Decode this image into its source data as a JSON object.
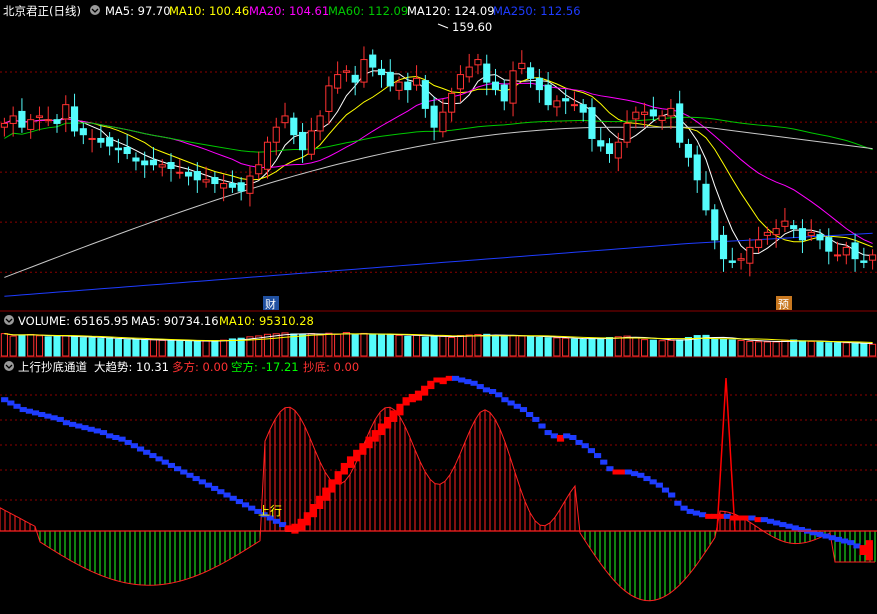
{
  "colors": {
    "background": "#000000",
    "up": "#FF3232",
    "down": "#54FCFC",
    "ma5": "#FFFFFF",
    "ma10": "#FFFF00",
    "ma20": "#FF00FF",
    "ma60": "#00C800",
    "ma120": "#C8C8C8",
    "ma250": "#1E3CFF",
    "grid": "#8B0000",
    "osc_bear": "#1E3CFF",
    "osc_bull": "#FF0000",
    "hist_pos": "#FF2020",
    "hist_neg": "#20FF20"
  },
  "price_panel": {
    "title": "北京君正(日线)",
    "legend": [
      {
        "label": "MA5: 97.70",
        "color": "#FFFFFF"
      },
      {
        "label": "MA10: 100.46",
        "color": "#FFFF00"
      },
      {
        "label": "MA20: 104.61",
        "color": "#FF00FF"
      },
      {
        "label": "MA60: 112.09",
        "color": "#00C800"
      },
      {
        "label": "MA120: 124.09",
        "color": "#FFFFFF"
      },
      {
        "label": "MA250: 112.56",
        "color": "#1E3CFF"
      }
    ],
    "peak_label": "159.60",
    "markers": [
      {
        "text": "财",
        "bg": "#2050A0",
        "fg": "#FFFFFF"
      },
      {
        "text": "预",
        "bg": "#C87820",
        "fg": "#FFFFFF"
      }
    ]
  },
  "volume_panel": {
    "legend": [
      {
        "label": "VOLUME: 65165.95",
        "color": "#FFFFFF"
      },
      {
        "label": "MA5: 90734.16",
        "color": "#FFFFFF"
      },
      {
        "label": "MA10: 95310.28",
        "color": "#FFFF00"
      }
    ]
  },
  "indicator_panel": {
    "legend": [
      {
        "label": "上行抄底通道",
        "color": "#FFFFFF"
      },
      {
        "label": "大趋势: 10.31",
        "color": "#FFFFFF"
      },
      {
        "label": "多方: 0.00",
        "color": "#FF3232"
      },
      {
        "label": "空方: -17.21",
        "color": "#00FF00"
      },
      {
        "label": "抄底: 0.00",
        "color": "#FF3232"
      }
    ],
    "annotation": "上行"
  },
  "chart_data": [
    {
      "type": "candlestick",
      "title": "北京君正(日线)",
      "bars": 100,
      "price_range": [
        88,
        162
      ],
      "peak": 159.6,
      "ma": {
        "MA5": 97.7,
        "MA10": 100.46,
        "MA20": 104.61,
        "MA60": 112.09,
        "MA120": 124.09,
        "MA250": 112.56
      },
      "closes": [
        135,
        137,
        134,
        136,
        137,
        136,
        135,
        140,
        133,
        132,
        131,
        130,
        129,
        128,
        127,
        125,
        124,
        124,
        124,
        123,
        122,
        121,
        120,
        120,
        119,
        119,
        118,
        117,
        121,
        124,
        130,
        134,
        137,
        132,
        128,
        133,
        137,
        145,
        148,
        149,
        146,
        152,
        150,
        148,
        145,
        146,
        144,
        147,
        139,
        134,
        138,
        143,
        148,
        150,
        152,
        146,
        144,
        141,
        149,
        151,
        147,
        144,
        140,
        141,
        141,
        140,
        138,
        131,
        129,
        127,
        130,
        135,
        138,
        138,
        137,
        137,
        139,
        130,
        126,
        120,
        112,
        104,
        99,
        98,
        99,
        102,
        104,
        106,
        107,
        109,
        107,
        104,
        106,
        104,
        101,
        100,
        102,
        99,
        98,
        100
      ],
      "grid": true
    },
    {
      "type": "bar",
      "title": "VOLUME",
      "values": [
        126000,
        112000,
        118000,
        121000,
        114000,
        108000,
        110000,
        113000,
        108000,
        103000,
        101000,
        98000,
        99000,
        94000,
        92000,
        90000,
        90000,
        91000,
        88000,
        87000,
        84000,
        84000,
        82000,
        84000,
        86000,
        89000,
        96000,
        100000,
        108000,
        113000,
        122000,
        125000,
        130000,
        124000,
        120000,
        126000,
        118000,
        128000,
        122000,
        132000,
        118000,
        127000,
        123000,
        119000,
        121000,
        116000,
        110000,
        116000,
        106000,
        113000,
        110000,
        104000,
        115000,
        118000,
        121000,
        122000,
        114000,
        111000,
        114000,
        112000,
        111000,
        104000,
        103000,
        102000,
        100000,
        95000,
        93000,
        98000,
        101000,
        104000,
        108000,
        112000,
        103000,
        92000,
        89000,
        86000,
        88000,
        91000,
        104000,
        115000,
        116000,
        96000,
        93000,
        90000,
        87000,
        82000,
        80000,
        79000,
        79000,
        88000,
        90000,
        85000,
        82000,
        78000,
        75000,
        73000,
        74000,
        70000,
        68000,
        66000
      ],
      "ma5": 90734.16,
      "ma10": 95310.28
    },
    {
      "type": "line",
      "title": "上行抄底通道",
      "series": [
        {
          "name": "大趋势",
          "values": [
            88,
            86,
            84,
            82,
            81,
            80,
            79,
            78,
            77,
            76,
            74,
            73,
            72,
            71,
            70,
            69,
            68,
            66,
            65,
            64,
            62,
            60,
            58,
            56,
            54,
            52,
            50,
            48,
            46,
            44,
            42,
            40,
            38,
            36,
            34,
            32,
            30,
            28,
            26,
            24,
            22,
            20,
            18,
            16,
            14,
            12,
            10,
            11,
            14,
            18,
            23,
            28,
            33,
            38,
            43,
            48,
            52,
            56,
            60,
            64,
            68,
            72,
            76,
            80,
            84,
            88,
            90,
            92,
            95,
            98,
            100,
            100,
            101,
            101,
            100,
            99,
            98,
            96,
            94,
            93,
            91,
            88,
            86,
            84,
            82,
            79,
            76,
            72,
            68,
            66,
            65,
            66,
            65,
            62,
            60,
            57,
            54,
            50,
            46,
            44,
            44,
            44,
            43,
            42,
            40,
            38,
            36,
            33,
            30,
            25,
            22,
            20,
            19,
            18,
            17,
            17,
            17,
            17,
            16,
            16,
            16,
            16,
            15,
            15,
            14,
            13,
            12,
            11,
            10,
            9,
            8,
            7,
            6,
            5,
            4,
            3,
            2,
            1,
            -1,
            -2,
            1,
            10.31
          ]
        },
        {
          "name": "多方",
          "values": [
            0.0
          ]
        },
        {
          "name": "空方",
          "values": [
            -17.21
          ]
        },
        {
          "name": "抄底",
          "values": [
            0.0
          ]
        }
      ],
      "ylim": [
        -40,
        100
      ]
    }
  ]
}
